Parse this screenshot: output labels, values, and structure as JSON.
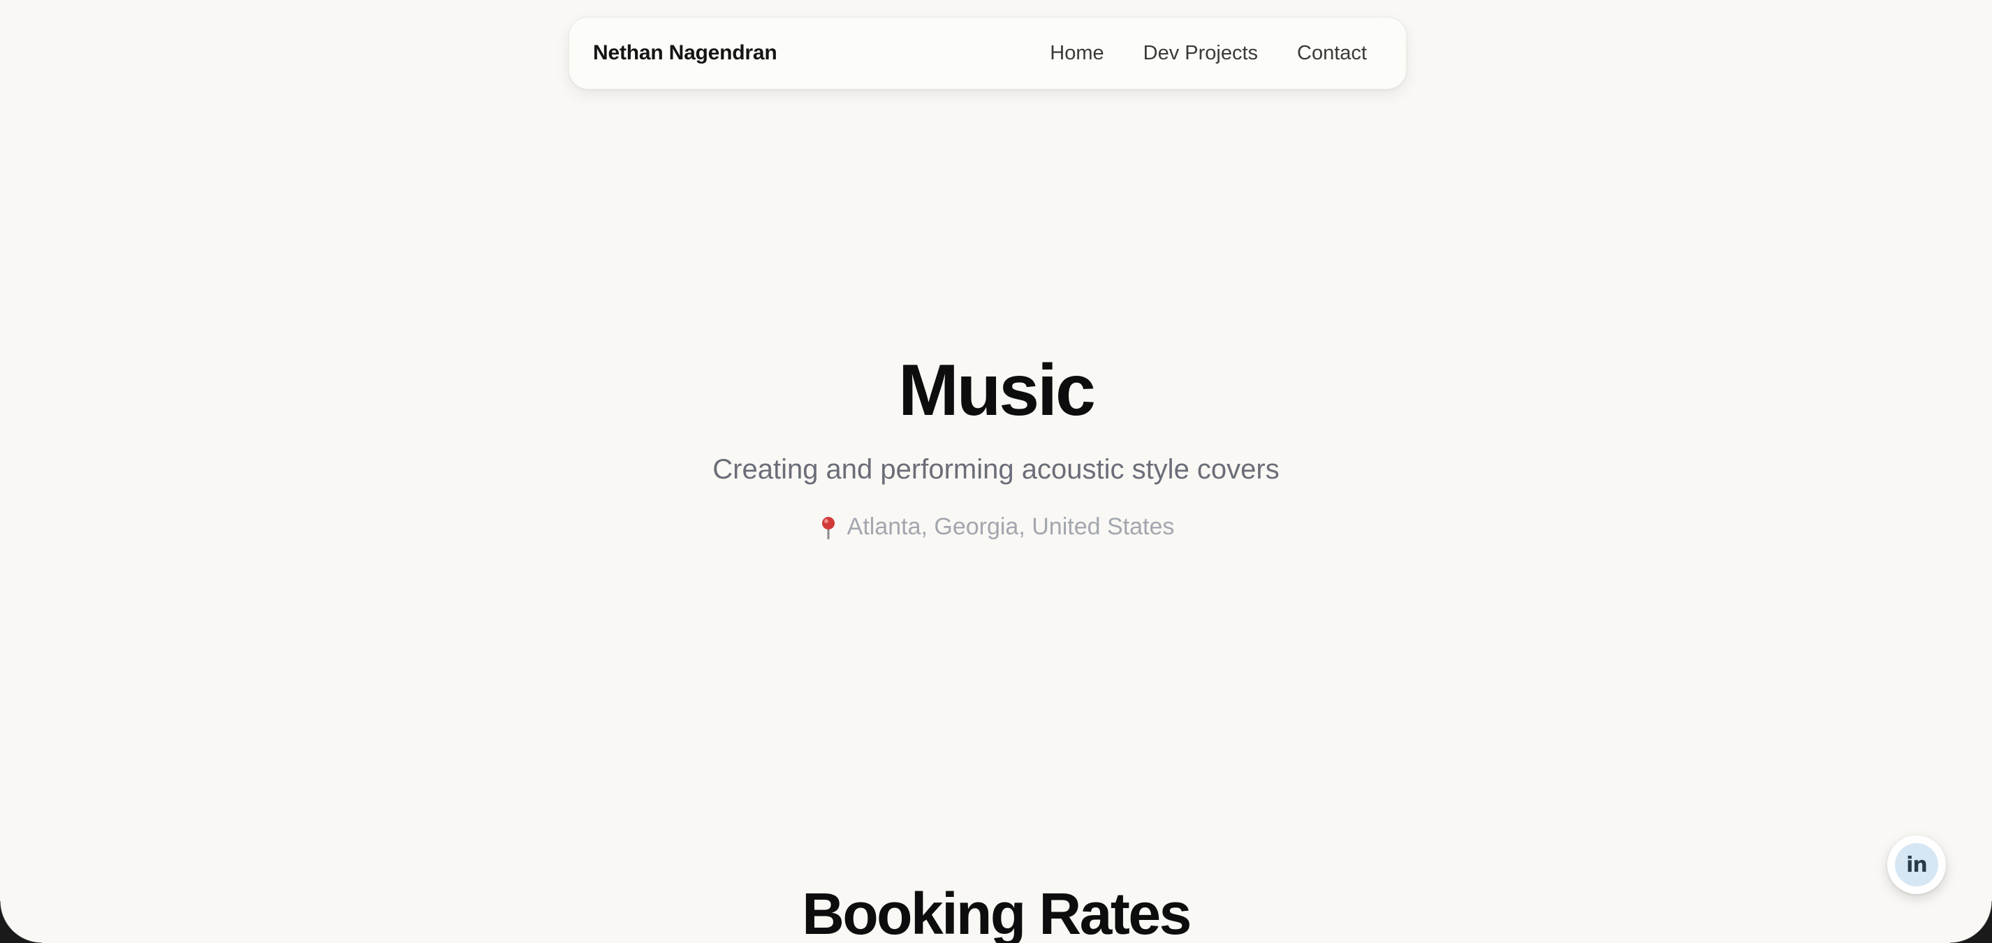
{
  "nav": {
    "brand": "Nethan Nagendran",
    "links": [
      {
        "label": "Home"
      },
      {
        "label": "Dev Projects"
      },
      {
        "label": "Contact"
      }
    ]
  },
  "hero": {
    "title": "Music",
    "subtitle": "Creating and performing acoustic style covers",
    "location_icon": "pin-icon",
    "location": "Atlanta, Georgia, United States"
  },
  "booking": {
    "title": "Booking Rates"
  },
  "social": {
    "linkedin_icon": "linkedin-icon",
    "linkedin_text": "in"
  },
  "colors": {
    "background": "#f9f8f5",
    "navbar_bg": "#fcfcf9",
    "heading": "#0d0d0d",
    "subtitle": "#6b6e78",
    "location": "#a3a6ae",
    "pin": "#d23a3a",
    "linkedin_bg": "#d6e6f3"
  }
}
